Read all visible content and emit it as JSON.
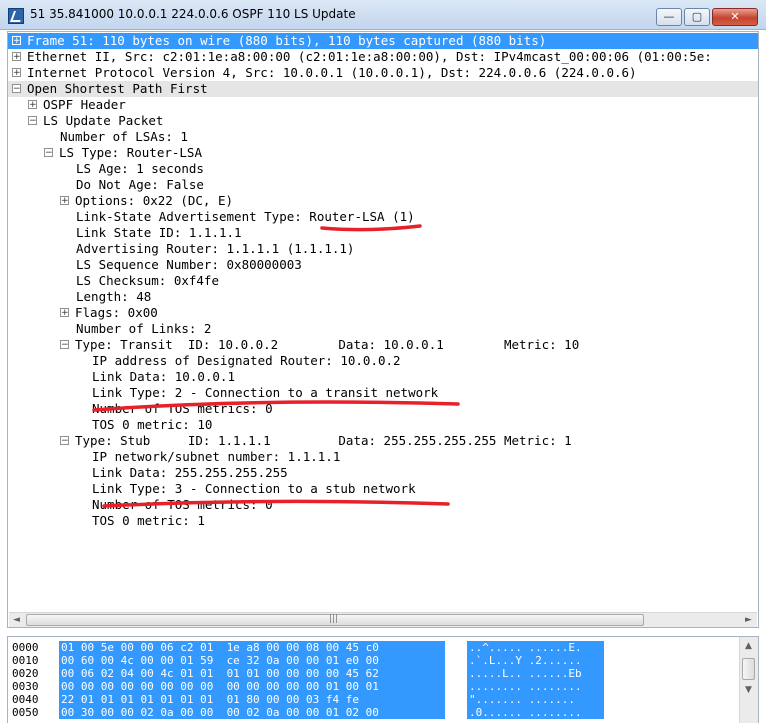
{
  "window": {
    "title": "51 35.841000 10.0.0.1 224.0.0.6 OSPF 110 LS Update",
    "minimize_glyph": "—",
    "maximize_glyph": "▢",
    "close_glyph": "✕"
  },
  "tree": [
    {
      "text": "Frame 51: 110 bytes on wire (880 bits), 110 bytes captured (880 bits)",
      "toggle": "+",
      "state": "selected"
    },
    {
      "text": "Ethernet II, Src: c2:01:1e:a8:00:00 (c2:01:1e:a8:00:00), Dst: IPv4mcast_00:00:06 (01:00:5e:",
      "toggle": "+",
      "state": ""
    },
    {
      "text": "Internet Protocol Version 4, Src: 10.0.0.1 (10.0.0.1), Dst: 224.0.0.6 (224.0.0.6)",
      "toggle": "+",
      "state": ""
    },
    {
      "text": "Open Shortest Path First",
      "toggle": "−",
      "state": "shaded"
    },
    {
      "text": "OSPF Header",
      "toggle": "+",
      "state": ""
    },
    {
      "text": "LS Update Packet",
      "toggle": "−",
      "state": ""
    },
    {
      "text": "Number of LSAs: 1",
      "toggle": "",
      "state": ""
    },
    {
      "text": "LS Type: Router-LSA",
      "toggle": "−",
      "state": ""
    },
    {
      "text": "LS Age: 1 seconds",
      "toggle": "",
      "state": ""
    },
    {
      "text": "Do Not Age: False",
      "toggle": "",
      "state": ""
    },
    {
      "text": "Options: 0x22 (DC, E)",
      "toggle": "+",
      "state": ""
    },
    {
      "text": "Link-State Advertisement Type: Router-LSA (1)",
      "toggle": "",
      "state": ""
    },
    {
      "text": "Link State ID: 1.1.1.1",
      "toggle": "",
      "state": ""
    },
    {
      "text": "Advertising Router: 1.1.1.1 (1.1.1.1)",
      "toggle": "",
      "state": ""
    },
    {
      "text": "LS Sequence Number: 0x80000003",
      "toggle": "",
      "state": ""
    },
    {
      "text": "LS Checksum: 0xf4fe",
      "toggle": "",
      "state": ""
    },
    {
      "text": "Length: 48",
      "toggle": "",
      "state": ""
    },
    {
      "text": "Flags: 0x00",
      "toggle": "+",
      "state": ""
    },
    {
      "text": "Number of Links: 2",
      "toggle": "",
      "state": ""
    },
    {
      "text": "Type: Transit  ID: 10.0.0.2        Data: 10.0.0.1        Metric: 10",
      "toggle": "−",
      "state": ""
    },
    {
      "text": "IP address of Designated Router: 10.0.0.2",
      "toggle": "",
      "state": ""
    },
    {
      "text": "Link Data: 10.0.0.1",
      "toggle": "",
      "state": ""
    },
    {
      "text": "Link Type: 2 - Connection to a transit network",
      "toggle": "",
      "state": ""
    },
    {
      "text": "Number of TOS metrics: 0",
      "toggle": "",
      "state": ""
    },
    {
      "text": "TOS 0 metric: 10",
      "toggle": "",
      "state": ""
    },
    {
      "text": "Type: Stub     ID: 1.1.1.1         Data: 255.255.255.255 Metric: 1",
      "toggle": "−",
      "state": ""
    },
    {
      "text": "IP network/subnet number: 1.1.1.1",
      "toggle": "",
      "state": ""
    },
    {
      "text": "Link Data: 255.255.255.255",
      "toggle": "",
      "state": ""
    },
    {
      "text": "Link Type: 3 - Connection to a stub network",
      "toggle": "",
      "state": ""
    },
    {
      "text": "Number of TOS metrics: 0",
      "toggle": "",
      "state": ""
    },
    {
      "text": "TOS 0 metric: 1",
      "toggle": "",
      "state": ""
    }
  ],
  "hscroll": {
    "left_arrow": "◄",
    "right_arrow": "►",
    "grip": "|||"
  },
  "hex_dump": [
    {
      "offset": "0000",
      "bytes": "01 00 5e 00 00 06 c2 01  1e a8 00 00 08 00 45 c0",
      "ascii": "..^..... ......E."
    },
    {
      "offset": "0010",
      "bytes": "00 60 00 4c 00 00 01 59  ce 32 0a 00 00 01 e0 00",
      "ascii": ".`.L...Y .2......"
    },
    {
      "offset": "0020",
      "bytes": "00 06 02 04 00 4c 01 01  01 01 00 00 00 00 45 62",
      "ascii": ".....L.. ......Eb"
    },
    {
      "offset": "0030",
      "bytes": "00 00 00 00 00 00 00 00  00 00 00 00 00 01 00 01",
      "ascii": "........ ........"
    },
    {
      "offset": "0040",
      "bytes": "22 01 01 01 01 01 01 01  01 80 00 00 03 f4 fe",
      "ascii": "\"....... ......."
    },
    {
      "offset": "0050",
      "bytes": "00 30 00 00 02 0a 00 00  00 02 0a 00 00 01 02 00",
      "ascii": ".0...... ........"
    }
  ],
  "vscroll": {
    "up_arrow": "▲",
    "down_arrow": "▼"
  },
  "annotation": {
    "color": "#e8202a"
  }
}
